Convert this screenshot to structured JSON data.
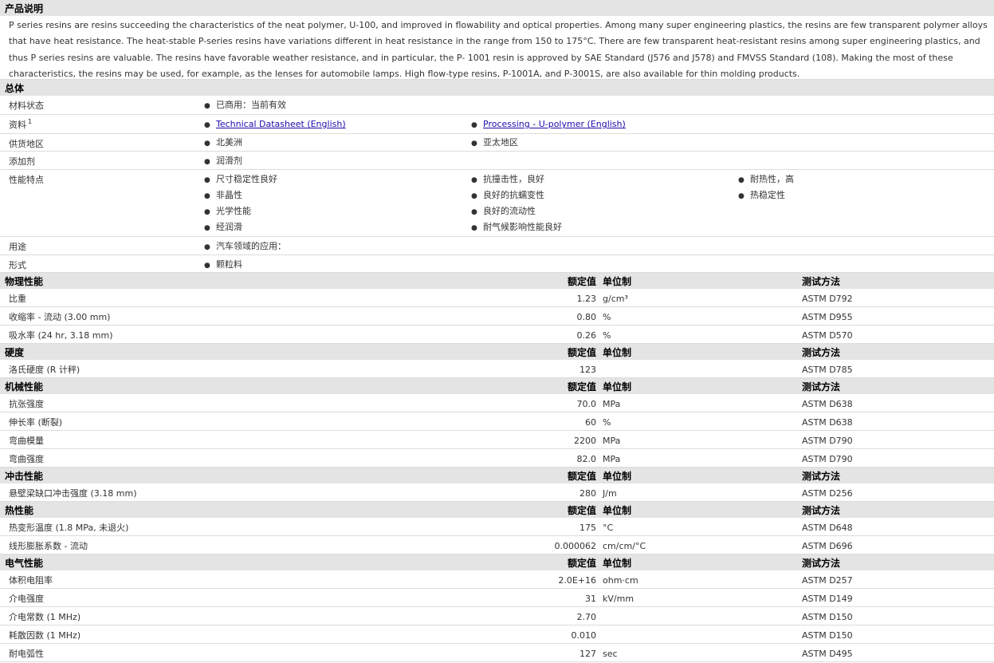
{
  "description": {
    "title": "产品说明",
    "text": "P series resins are resins succeeding the characteristics of the neat polymer, U-100, and improved in flowability and optical properties. Among many super engineering plastics, the resins are few transparent polymer alloys that have heat resistance. The heat-stable P-series resins have variations different in heat resistance in the range from 150 to 175°C. There are few transparent heat-resistant resins among super engineering plastics, and thus P series resins are valuable. The resins have favorable weather resistance, and in particular, the P- 1001 resin is approved by SAE Standard (J576 and J578) and FMVSS Standard (108). Making the most of these characteristics, the resins may be used, for example, as the lenses for automobile lamps. High flow-type resins, P-1001A, and P-3001S, are also available for thin molding products."
  },
  "bullet": "●",
  "general": {
    "title": "总体",
    "rows": [
      {
        "label": "材料状态",
        "cols": [
          [
            "已商用：当前有效"
          ]
        ]
      },
      {
        "label": "资料",
        "sup": "1",
        "links": [
          "Technical Datasheet (English)",
          "Processing - U-polymer (English)"
        ]
      },
      {
        "label": "供货地区",
        "cols": [
          [
            "北美洲"
          ],
          [
            "亚太地区"
          ]
        ]
      },
      {
        "label": "添加剂",
        "cols": [
          [
            "润滑剂"
          ]
        ]
      },
      {
        "label": "性能特点",
        "cols": [
          [
            "尺寸稳定性良好",
            "非晶性",
            "光学性能",
            "经润滑"
          ],
          [
            "抗撞击性，良好",
            "良好的抗蠕变性",
            "良好的流动性",
            "耐气候影响性能良好"
          ],
          [
            "耐热性，高",
            "热稳定性"
          ]
        ]
      },
      {
        "label": "用途",
        "cols": [
          [
            "汽车领域的应用："
          ]
        ]
      },
      {
        "label": "形式",
        "cols": [
          [
            "颗粒料"
          ]
        ]
      }
    ]
  },
  "column_headers": {
    "value": "额定值",
    "unit": "单位制",
    "method": "测试方法"
  },
  "property_sections": [
    {
      "title": "物理性能",
      "rows": [
        {
          "label": "比重",
          "value": "1.23",
          "unit": "g/cm³",
          "method": "ASTM D792"
        },
        {
          "label": "收缩率 - 流动 (3.00 mm)",
          "value": "0.80",
          "unit": "%",
          "method": "ASTM D955"
        },
        {
          "label": "吸水率 (24 hr, 3.18 mm)",
          "value": "0.26",
          "unit": "%",
          "method": "ASTM D570"
        }
      ]
    },
    {
      "title": "硬度",
      "rows": [
        {
          "label": "洛氏硬度 (R 计秤)",
          "value": "123",
          "unit": "",
          "method": "ASTM D785"
        }
      ]
    },
    {
      "title": "机械性能",
      "rows": [
        {
          "label": "抗张强度",
          "value": "70.0",
          "unit": "MPa",
          "method": "ASTM D638"
        },
        {
          "label": "伸长率 (断裂)",
          "value": "60",
          "unit": "%",
          "method": "ASTM D638"
        },
        {
          "label": "弯曲模量",
          "value": "2200",
          "unit": "MPa",
          "method": "ASTM D790"
        },
        {
          "label": "弯曲强度",
          "value": "82.0",
          "unit": "MPa",
          "method": "ASTM D790"
        }
      ]
    },
    {
      "title": "冲击性能",
      "rows": [
        {
          "label": "悬壁梁缺口冲击强度 (3.18 mm)",
          "value": "280",
          "unit": "J/m",
          "method": "ASTM D256"
        }
      ]
    },
    {
      "title": "热性能",
      "rows": [
        {
          "label": "热变形温度 (1.8 MPa, 未退火)",
          "value": "175",
          "unit": "°C",
          "method": "ASTM D648"
        },
        {
          "label": "线形膨胀系数 - 流动",
          "value": "0.000062",
          "unit": "cm/cm/°C",
          "method": "ASTM D696"
        }
      ]
    },
    {
      "title": "电气性能",
      "rows": [
        {
          "label": "体积电阻率",
          "value": "2.0E+16",
          "unit": "ohm·cm",
          "method": "ASTM D257"
        },
        {
          "label": "介电强度",
          "value": "31",
          "unit": "kV/mm",
          "method": "ASTM D149"
        },
        {
          "label": "介电常数 (1 MHz)",
          "value": "2.70",
          "unit": "",
          "method": "ASTM D150"
        },
        {
          "label": "耗散因数 (1 MHz)",
          "value": "0.010",
          "unit": "",
          "method": "ASTM D150"
        },
        {
          "label": "耐电弧性",
          "value": "127",
          "unit": "sec",
          "method": "ASTM D495"
        }
      ]
    }
  ]
}
